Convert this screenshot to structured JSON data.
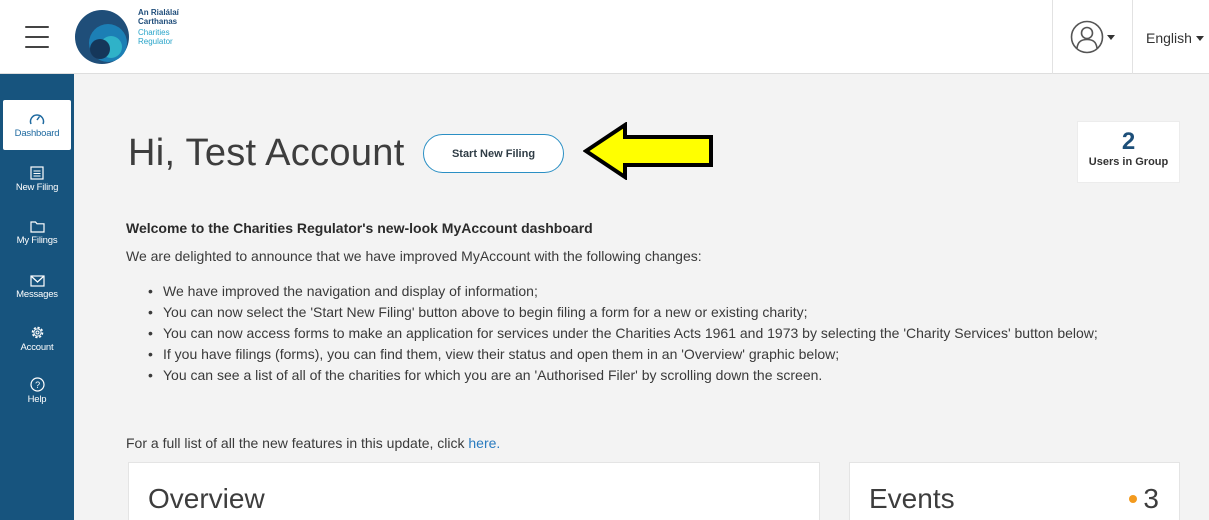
{
  "header": {
    "logo_text_irish": [
      "An Rialálaí",
      "Carthanas"
    ],
    "logo_text_english": [
      "Charities",
      "Regulator"
    ],
    "language": "English"
  },
  "sidebar": {
    "items": [
      {
        "label": "Dashboard",
        "icon": "gauge-icon",
        "active": true
      },
      {
        "label": "New Filing",
        "icon": "form-icon",
        "active": false
      },
      {
        "label": "My Filings",
        "icon": "folder-icon",
        "active": false
      },
      {
        "label": "Messages",
        "icon": "envelope-icon",
        "active": false
      },
      {
        "label": "Account",
        "icon": "gear-icon",
        "active": false
      },
      {
        "label": "Help",
        "icon": "help-icon",
        "active": false
      }
    ]
  },
  "main": {
    "greeting": "Hi, Test Account",
    "start_button": "Start New Filing",
    "users_count": "2",
    "users_label": "Users in Group",
    "welcome_title": "Welcome to the Charities Regulator's new-look MyAccount dashboard",
    "intro": "We are delighted to announce that we have improved MyAccount with the following changes:",
    "bullets": [
      "We have improved the navigation and display of information;",
      "You can now select the 'Start New Filing' button above to begin filing a form for a new or existing charity;",
      "You can now access forms to make an application for services under the Charities Acts 1961 and 1973 by selecting the 'Charity Services' button below;",
      "If you have filings (forms), you can find them, view their status and open them in an 'Overview' graphic below;",
      "You can see a list of all of the charities for which you are an 'Authorised Filer' by scrolling down the screen."
    ],
    "footer_text": "For a full list of all the new features in this update, click ",
    "footer_link": "here.",
    "overview_title": "Overview",
    "events_title": "Events",
    "events_count": "3"
  },
  "colors": {
    "sidebar_bg": "#17547e",
    "accent_blue": "#2a8fc4",
    "arrow_yellow": "#ffff00",
    "events_dot": "#f39a1e"
  }
}
